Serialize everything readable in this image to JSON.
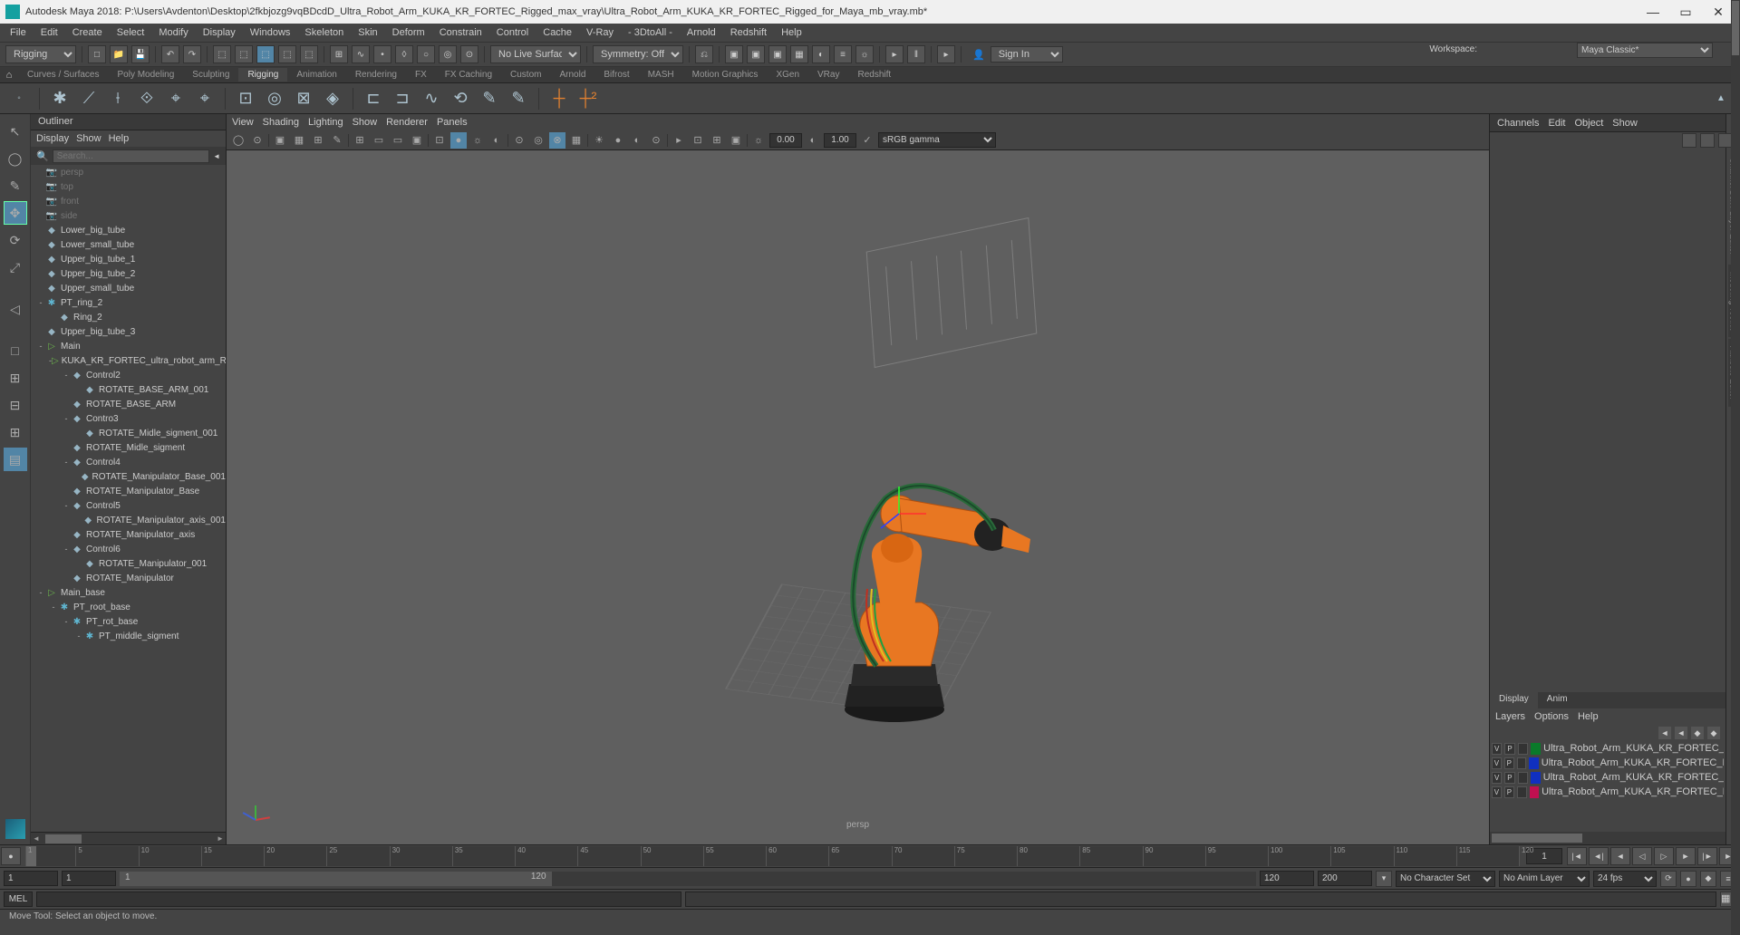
{
  "title": "Autodesk Maya 2018: P:\\Users\\Avdenton\\Desktop\\2fkbjozg9vqBDcdD_Ultra_Robot_Arm_KUKA_KR_FORTEC_Rigged_max_vray\\Ultra_Robot_Arm_KUKA_KR_FORTEC_Rigged_for_Maya_mb_vray.mb*",
  "workspace": {
    "label": "Workspace:",
    "value": "Maya Classic*"
  },
  "menubar": [
    "File",
    "Edit",
    "Create",
    "Select",
    "Modify",
    "Display",
    "Windows",
    "Skeleton",
    "Skin",
    "Deform",
    "Constrain",
    "Control",
    "Cache",
    "V-Ray",
    "- 3DtoAll -",
    "Arnold",
    "Redshift",
    "Help"
  ],
  "shelfTop": {
    "mode": "Rigging",
    "noLive": "No Live Surface",
    "symmetry": "Symmetry: Off",
    "signin": "Sign In"
  },
  "shelfTabs": [
    "Curves / Surfaces",
    "Poly Modeling",
    "Sculpting",
    "Rigging",
    "Animation",
    "Rendering",
    "FX",
    "FX Caching",
    "Custom",
    "Arnold",
    "Bifrost",
    "MASH",
    "Motion Graphics",
    "XGen",
    "VRay",
    "Redshift"
  ],
  "activeShelfTab": "Rigging",
  "outliner": {
    "title": "Outliner",
    "menu": [
      "Display",
      "Show",
      "Help"
    ],
    "searchPlaceholder": "Search...",
    "items": [
      {
        "depth": 0,
        "icon": "cam",
        "name": "persp",
        "dim": true
      },
      {
        "depth": 0,
        "icon": "cam",
        "name": "top",
        "dim": true
      },
      {
        "depth": 0,
        "icon": "cam",
        "name": "front",
        "dim": true
      },
      {
        "depth": 0,
        "icon": "cam",
        "name": "side",
        "dim": true
      },
      {
        "depth": 0,
        "icon": "mesh",
        "name": "Lower_big_tube"
      },
      {
        "depth": 0,
        "icon": "mesh",
        "name": "Lower_small_tube"
      },
      {
        "depth": 0,
        "icon": "mesh",
        "name": "Upper_big_tube_1"
      },
      {
        "depth": 0,
        "icon": "mesh",
        "name": "Upper_big_tube_2"
      },
      {
        "depth": 0,
        "icon": "mesh",
        "name": "Upper_small_tube"
      },
      {
        "depth": 0,
        "icon": "nurbs",
        "name": "PT_ring_2",
        "exp": "-"
      },
      {
        "depth": 1,
        "icon": "mesh",
        "name": "Ring_2"
      },
      {
        "depth": 0,
        "icon": "mesh",
        "name": "Upper_big_tube_3"
      },
      {
        "depth": 0,
        "icon": "grp",
        "name": "Main",
        "exp": "-"
      },
      {
        "depth": 1,
        "icon": "grp",
        "name": "KUKA_KR_FORTEC_ultra_robot_arm_REC",
        "exp": "-"
      },
      {
        "depth": 2,
        "icon": "mesh",
        "name": "Control2",
        "exp": "-"
      },
      {
        "depth": 3,
        "icon": "mesh",
        "name": "ROTATE_BASE_ARM_001"
      },
      {
        "depth": 2,
        "icon": "mesh",
        "name": "ROTATE_BASE_ARM"
      },
      {
        "depth": 2,
        "icon": "mesh",
        "name": "Contro3",
        "exp": "-"
      },
      {
        "depth": 3,
        "icon": "mesh",
        "name": "ROTATE_Midle_sigment_001"
      },
      {
        "depth": 2,
        "icon": "mesh",
        "name": "ROTATE_Midle_sigment"
      },
      {
        "depth": 2,
        "icon": "mesh",
        "name": "Control4",
        "exp": "-"
      },
      {
        "depth": 3,
        "icon": "mesh",
        "name": "ROTATE_Manipulator_Base_001"
      },
      {
        "depth": 2,
        "icon": "mesh",
        "name": "ROTATE_Manipulator_Base"
      },
      {
        "depth": 2,
        "icon": "mesh",
        "name": "Control5",
        "exp": "-"
      },
      {
        "depth": 3,
        "icon": "mesh",
        "name": "ROTATE_Manipulator_axis_001"
      },
      {
        "depth": 2,
        "icon": "mesh",
        "name": "ROTATE_Manipulator_axis"
      },
      {
        "depth": 2,
        "icon": "mesh",
        "name": "Control6",
        "exp": "-"
      },
      {
        "depth": 3,
        "icon": "mesh",
        "name": "ROTATE_Manipulator_001"
      },
      {
        "depth": 2,
        "icon": "mesh",
        "name": "ROTATE_Manipulator"
      },
      {
        "depth": 0,
        "icon": "grp",
        "name": "Main_base",
        "exp": "-"
      },
      {
        "depth": 1,
        "icon": "nurbs",
        "name": "PT_root_base",
        "exp": "-"
      },
      {
        "depth": 2,
        "icon": "nurbs",
        "name": "PT_rot_base",
        "exp": "-"
      },
      {
        "depth": 3,
        "icon": "nurbs",
        "name": "PT_middle_sigment",
        "exp": "-"
      }
    ]
  },
  "viewport": {
    "menu": [
      "View",
      "Shading",
      "Lighting",
      "Show",
      "Renderer",
      "Panels"
    ],
    "near": "0.00",
    "far": "1.00",
    "colorSpace": "sRGB gamma",
    "cameraLabel": "persp"
  },
  "channelBox": {
    "tabs": [
      "Channels",
      "Edit",
      "Object",
      "Show"
    ]
  },
  "vertTabs": [
    "Channel Box / Layer Editor",
    "Modeling Toolkit",
    "Attribute Editor"
  ],
  "layers": {
    "tabs": [
      "Display",
      "Anim"
    ],
    "menu": [
      "Layers",
      "Options",
      "Help"
    ],
    "rows": [
      {
        "v": "V",
        "p": "P",
        "color": "#0a7a2a",
        "name": "Ultra_Robot_Arm_KUKA_KR_FORTEC_Rigged_Bo"
      },
      {
        "v": "V",
        "p": "P",
        "color": "#1030c0",
        "name": "Ultra_Robot_Arm_KUKA_KR_FORTEC_Rigged_Contro"
      },
      {
        "v": "V",
        "p": "P",
        "color": "#1030c0",
        "name": "Ultra_Robot_Arm_KUKA_KR_FORTEC_Rigged_Hel"
      },
      {
        "v": "V",
        "p": "P",
        "color": "#c01050",
        "name": "Ultra_Robot_Arm_KUKA_KR_FORTEC_Rigged_Geom"
      }
    ]
  },
  "timeline": {
    "ticks": [
      1,
      5,
      10,
      15,
      20,
      25,
      30,
      35,
      40,
      45,
      50,
      55,
      60,
      65,
      70,
      75,
      80,
      85,
      90,
      95,
      100,
      105,
      110,
      115,
      120
    ],
    "current": "1",
    "rangeStart": "1",
    "rangeInnerStart": "1",
    "rangeInnerEnd": "120",
    "rangeEnd": "200",
    "charSet": "No Character Set",
    "animLayer": "No Anim Layer",
    "fps": "24 fps"
  },
  "cmd": {
    "lang": "MEL"
  },
  "helpline": "Move Tool: Select an object to move."
}
